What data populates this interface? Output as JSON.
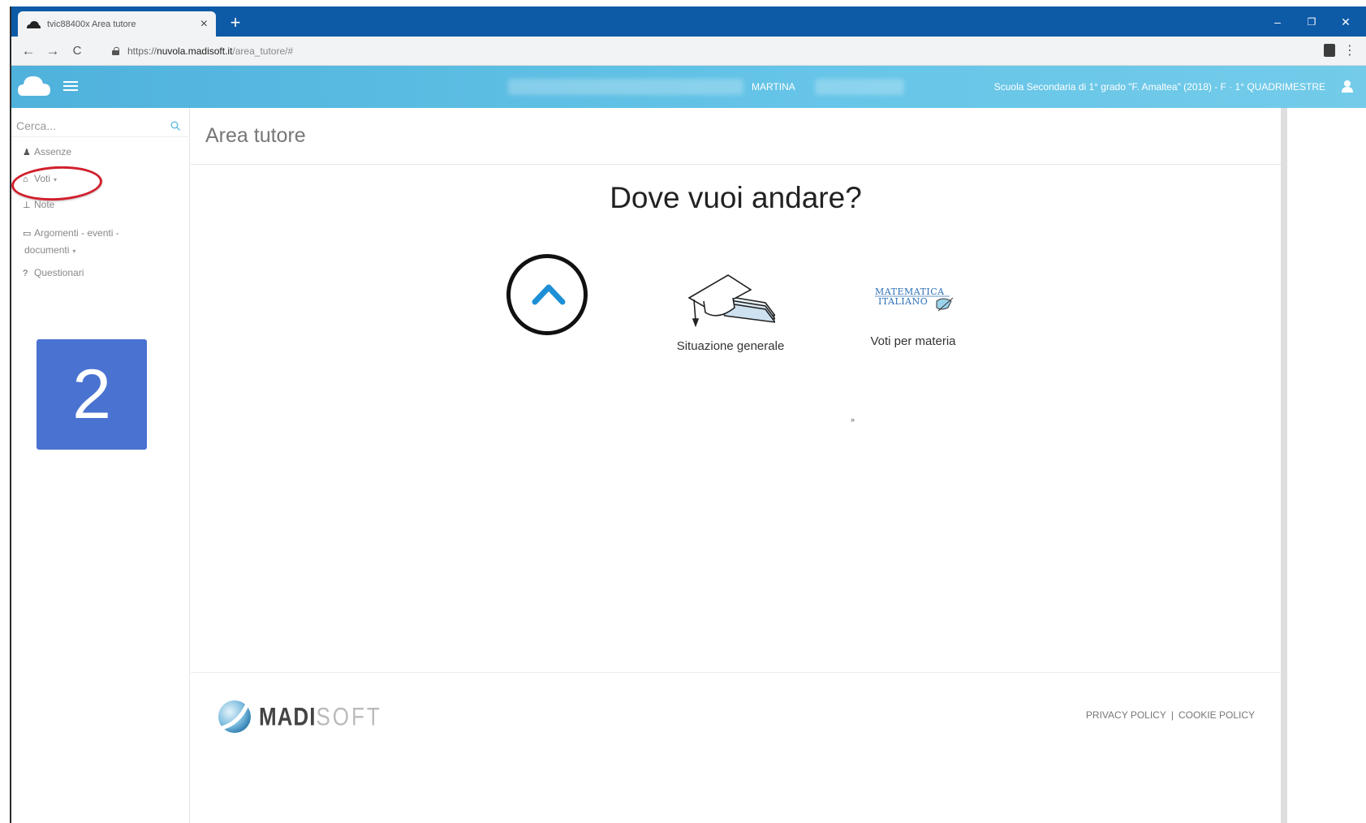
{
  "browser": {
    "tab_title": "tvic88400x Area tutore",
    "tab_close": "×",
    "new_tab": "+",
    "window_minimize": "–",
    "window_restore": "❐",
    "window_close": "✕",
    "back": "←",
    "forward": "→",
    "reload": "C",
    "url_prefix": "https://",
    "url_host": "nuvola.madisoft.it",
    "url_path": "/area_tutore/#",
    "menu": "⋮"
  },
  "header": {
    "user_name": "MARTINA",
    "school_info": "Scuola Secondaria di 1° grado \"F. Amaltea\" (2018) - F · 1° QUADRIMESTRE",
    "accent_color": "#5bbbe2"
  },
  "sidebar": {
    "search_placeholder": "Cerca...",
    "items": [
      {
        "label": "Assenze",
        "icon": "user-icon",
        "glyph": "♟",
        "has_caret": false
      },
      {
        "label": "Voti",
        "icon": "bank-icon",
        "glyph": "⌂",
        "has_caret": true,
        "highlighted": true
      },
      {
        "label": "Note",
        "icon": "pin-icon",
        "glyph": "⊥",
        "has_caret": false
      },
      {
        "label": "Argomenti - eventi -",
        "label_line2": "documenti",
        "icon": "folder-icon",
        "glyph": "▭",
        "has_caret": true
      },
      {
        "label": "Questionari",
        "icon": "question-icon",
        "glyph": "?",
        "has_caret": false
      }
    ],
    "caret": "▾",
    "step_number": "2",
    "step_color": "#4a72d1"
  },
  "main": {
    "page_title": "Area tutore",
    "headline": "Dove vuoi andare?",
    "options": [
      {
        "label": "Situazione generale",
        "icon": "graduation-cap-icon"
      },
      {
        "label": "Voti per materia",
        "icon": "matematica-italiano-icon",
        "icon_text_1": "MATEMATICA",
        "icon_text_2": "ITALIANO"
      }
    ],
    "tiny_mark": "»"
  },
  "footer": {
    "logo_bold": "MADI",
    "logo_light": "SOFT",
    "privacy": "PRIVACY POLICY",
    "separator": "|",
    "cookie": "COOKIE POLICY"
  }
}
